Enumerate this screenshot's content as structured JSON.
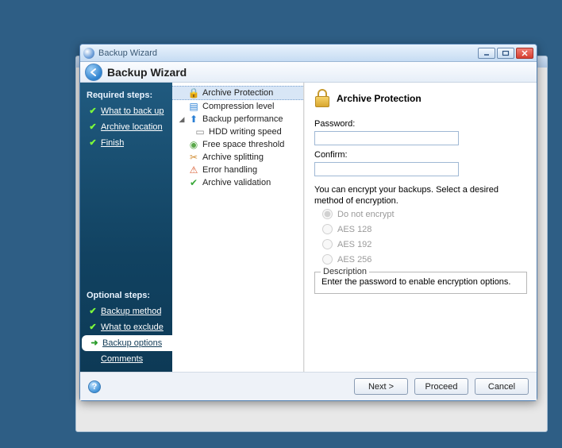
{
  "titlebar": {
    "title": "Backup Wizard"
  },
  "header": {
    "title": "Backup Wizard"
  },
  "sidebar": {
    "required_title": "Required steps:",
    "optional_title": "Optional steps:",
    "required_steps": [
      {
        "label": "What to back up"
      },
      {
        "label": "Archive location"
      },
      {
        "label": "Finish"
      }
    ],
    "optional_steps": [
      {
        "label": "Backup method"
      },
      {
        "label": "What to exclude"
      },
      {
        "label": "Backup options"
      },
      {
        "label": "Comments"
      }
    ]
  },
  "tree": {
    "items": [
      {
        "label": "Archive Protection"
      },
      {
        "label": "Compression level"
      },
      {
        "label": "Backup performance"
      },
      {
        "label": "HDD writing speed"
      },
      {
        "label": "Free space threshold"
      },
      {
        "label": "Archive splitting"
      },
      {
        "label": "Error handling"
      },
      {
        "label": "Archive validation"
      }
    ]
  },
  "panel": {
    "title": "Archive Protection",
    "password_label": "Password:",
    "confirm_label": "Confirm:",
    "password_value": "",
    "confirm_value": "",
    "hint": "You can encrypt your backups. Select a desired method of encryption.",
    "radios": [
      {
        "label": "Do not encrypt",
        "checked": true
      },
      {
        "label": "AES 128",
        "checked": false
      },
      {
        "label": "AES 192",
        "checked": false
      },
      {
        "label": "AES 256",
        "checked": false
      }
    ],
    "description_title": "Description",
    "description_text": "Enter the password to enable encryption options."
  },
  "footer": {
    "next": "Next >",
    "proceed": "Proceed",
    "cancel": "Cancel"
  }
}
